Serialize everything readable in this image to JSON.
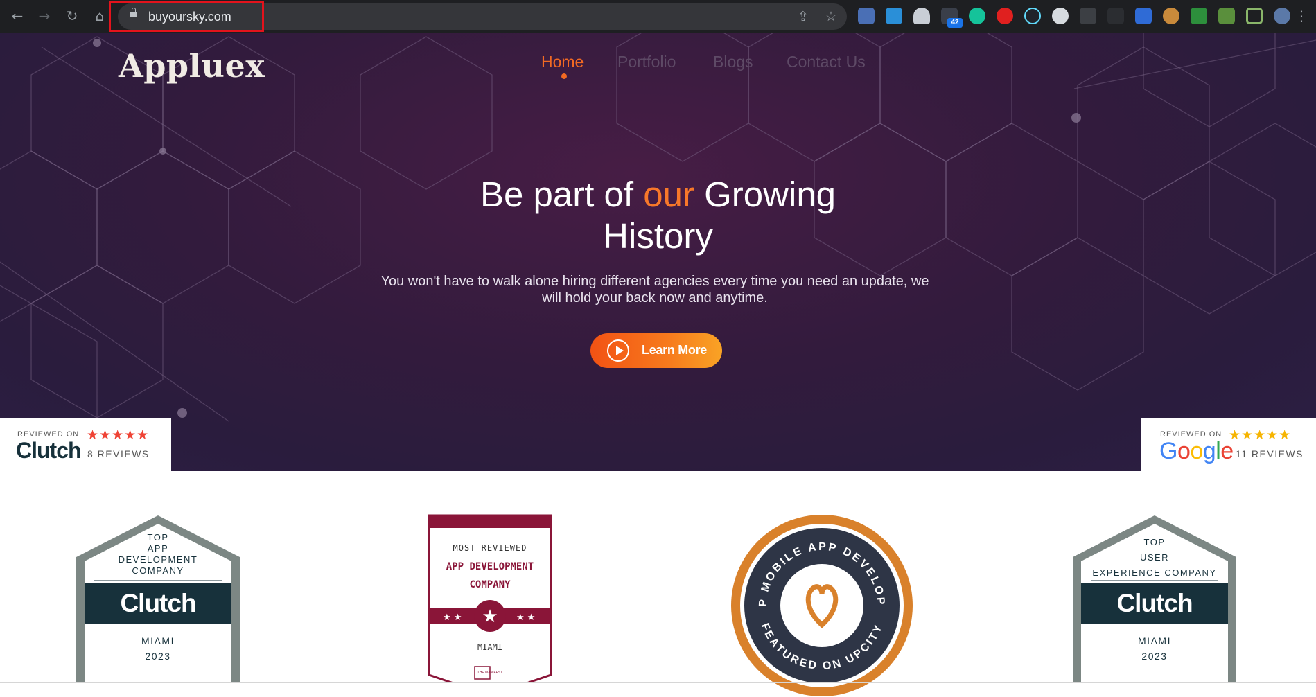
{
  "browser": {
    "url": "buyoursky.com",
    "extension_badge_count": "42",
    "icons": [
      "back-icon",
      "forward-icon",
      "reload-icon",
      "home-icon",
      "share-icon",
      "bookmark-star-icon",
      "extensions-icon",
      "side-panel-icon",
      "profile-icon",
      "menu-icon"
    ]
  },
  "site": {
    "brand": "Appluex",
    "nav": [
      {
        "label": "Home",
        "active": true
      },
      {
        "label": "Portfolio",
        "active": false
      },
      {
        "label": "Blogs",
        "active": false
      },
      {
        "label": "Contact Us",
        "active": false
      }
    ],
    "hero": {
      "headline_part1": "Be part of ",
      "headline_accent": "our",
      "headline_part2": " Growing",
      "headline_line2": "History",
      "subtext_line1": "You won't have to walk alone hiring different agencies every time you need an update, we",
      "subtext_line2": "will hold your back now and anytime.",
      "cta_label": "Learn More"
    },
    "reviews": [
      {
        "reviewed_on": "REVIEWED ON",
        "platform": "Clutch",
        "stars": 5,
        "count": "8 REVIEWS"
      },
      {
        "reviewed_on": "REVIEWED ON",
        "platform": "Google",
        "stars": 5,
        "count": "11 REVIEWS"
      }
    ],
    "badges": [
      {
        "line1": "TOP",
        "line2": "APP",
        "line3": "DEVELOPMENT",
        "line4": "COMPANY",
        "brand": "Clutch",
        "city": "MIAMI",
        "year": "2023"
      },
      {
        "line1": "MOST REVIEWED",
        "line2": "APP DEVELOPMENT",
        "line3": "COMPANY",
        "city": "MIAMI",
        "footer": "THE MANIFEST"
      },
      {
        "ring_top": "TOP MOBILE APP DEVELOPER",
        "ring_bottom": "FEATURED ON UPCITY"
      },
      {
        "line1": "TOP",
        "line2": "USER",
        "line3": "EXPERIENCE COMPANY",
        "brand": "Clutch",
        "city": "MIAMI",
        "year": "2023"
      }
    ]
  },
  "colors": {
    "accent_orange": "#f26a23",
    "hero_bg": "#331b3d",
    "browser_bar": "#1e1f22",
    "highlight_red": "#e3131c",
    "clutch_dark": "#17313b",
    "manifest_maroon": "#8a1538",
    "upcity_orange": "#d9812b"
  }
}
